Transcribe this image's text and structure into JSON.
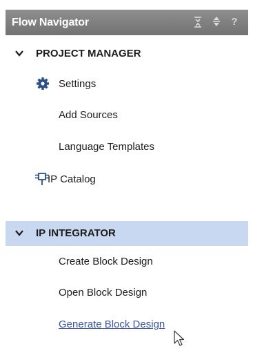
{
  "panel": {
    "title": "Flow Navigator",
    "toolbar_icons": [
      "collapse-all-icon",
      "expand-all-icon",
      "help-icon"
    ],
    "help_glyph": "?"
  },
  "sections": [
    {
      "label": "PROJECT MANAGER",
      "expanded": true,
      "selected": false,
      "items": [
        {
          "label": "Settings",
          "icon": "gear-icon"
        },
        {
          "label": "Add Sources",
          "icon": null
        },
        {
          "label": "Language Templates",
          "icon": null
        },
        {
          "label": "IP Catalog",
          "icon": "ip-catalog-icon"
        }
      ]
    },
    {
      "label": "IP INTEGRATOR",
      "expanded": true,
      "selected": true,
      "items": [
        {
          "label": "Create Block Design",
          "icon": null
        },
        {
          "label": "Open Block Design",
          "icon": null
        },
        {
          "label": "Generate Block Design",
          "icon": null,
          "hovered": true
        }
      ]
    }
  ],
  "colors": {
    "titlebar": "#7f7f7f",
    "selected_section": "#c8d8f0",
    "link": "#3a52a8",
    "icon_blue": "#2a4f8c"
  }
}
